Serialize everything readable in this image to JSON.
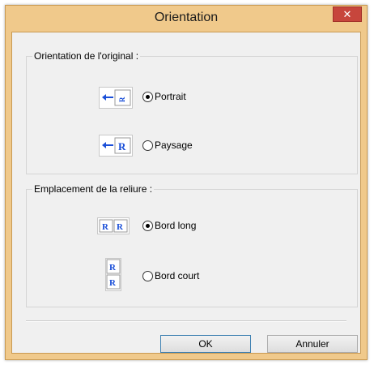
{
  "window": {
    "title": "Orientation",
    "close_symbol": "✕"
  },
  "orientation_group": {
    "label": "Orientation de l'original :",
    "options": [
      {
        "label": "Portrait",
        "selected": true,
        "icon": "portrait-orientation-icon"
      },
      {
        "label": "Paysage",
        "selected": false,
        "icon": "landscape-orientation-icon"
      }
    ]
  },
  "binding_group": {
    "label": "Emplacement de la reliure :",
    "options": [
      {
        "label": "Bord long",
        "selected": true,
        "icon": "long-edge-binding-icon"
      },
      {
        "label": "Bord court",
        "selected": false,
        "icon": "short-edge-binding-icon"
      }
    ]
  },
  "buttons": {
    "ok": "OK",
    "cancel": "Annuler"
  },
  "colors": {
    "frame": "#f0c98b",
    "close": "#c7463c",
    "client": "#f0f0f0",
    "icon_blue": "#1a4fd8"
  },
  "icon_glyph": {
    "letter": "R"
  }
}
